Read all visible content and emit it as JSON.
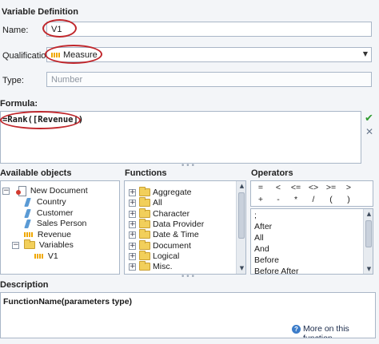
{
  "header": {
    "title": "Variable Definition"
  },
  "name_field": {
    "label": "Name:",
    "value": "V1"
  },
  "qualification": {
    "label": "Qualification:",
    "value": "Measure"
  },
  "type_field": {
    "label": "Type:",
    "placeholder": "Number"
  },
  "formula": {
    "label": "Formula:",
    "value": "=Rank([Revenue])",
    "validate_icon": "check-icon",
    "clear_icon": "close-icon"
  },
  "available_objects": {
    "title": "Available objects",
    "items": [
      {
        "label": "New Document",
        "icon": "document-icon"
      },
      {
        "label": "Country",
        "icon": "dimension-icon"
      },
      {
        "label": "Customer",
        "icon": "dimension-icon"
      },
      {
        "label": "Sales Person",
        "icon": "dimension-icon"
      },
      {
        "label": "Revenue",
        "icon": "measure-icon"
      },
      {
        "label": "Variables",
        "icon": "folder-icon"
      },
      {
        "label": "V1",
        "icon": "measure-icon"
      }
    ]
  },
  "functions": {
    "title": "Functions",
    "items": [
      {
        "label": "Aggregate"
      },
      {
        "label": "All"
      },
      {
        "label": "Character"
      },
      {
        "label": "Data Provider"
      },
      {
        "label": "Date & Time"
      },
      {
        "label": "Document"
      },
      {
        "label": "Logical"
      },
      {
        "label": "Misc."
      }
    ]
  },
  "operators": {
    "title": "Operators",
    "buttons": [
      "=",
      "<",
      "<=",
      "<>",
      ">=",
      ">",
      "+",
      "-",
      "*",
      "/",
      "(",
      ")"
    ],
    "list": [
      ";",
      "After",
      "All",
      "And",
      "Before",
      "Before After"
    ]
  },
  "description": {
    "title": "Description",
    "signature": "FunctionName(parameters type)",
    "help_link": "More on this function."
  },
  "colors": {
    "accent": "#c0262b",
    "border": "#a9b6c7",
    "check": "#2f9a2f"
  }
}
